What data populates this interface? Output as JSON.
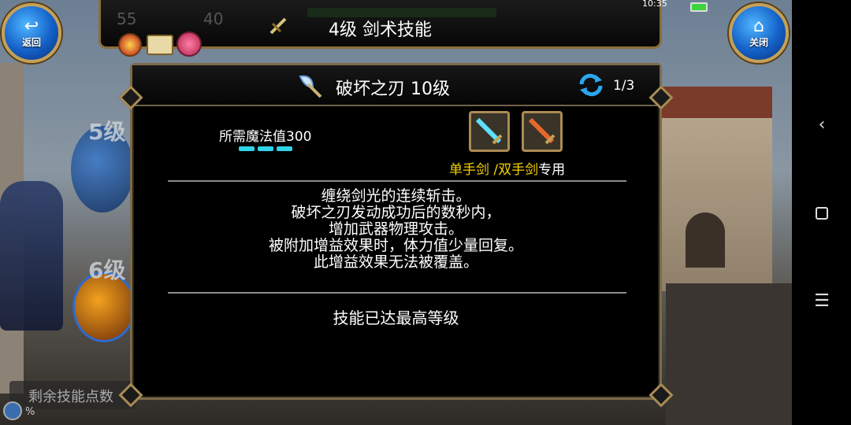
{
  "top_bar": {
    "title": "4级 剑术技能",
    "back_label": "返回",
    "close_label": "关闭",
    "faded_num_a": "55",
    "faded_num_b": "40"
  },
  "system": {
    "time": "10:35"
  },
  "background": {
    "level_5": "5级",
    "level_6": "6级",
    "remaining_points_label": "剩余技能点数",
    "percent": "%"
  },
  "skill": {
    "name": "破坏之刃 10级",
    "page": "1/3",
    "mp_label": "所需魔法值300",
    "weapon_note": "单手剑 /双手剑",
    "weapon_suffix": "专用",
    "description": [
      "缠绕剑光的连续斩击。",
      "破坏之刃发动成功后的数秒内，",
      "增加武器物理攻击。",
      "被附加增益效果时，体力值少量回复。",
      "此增益效果无法被覆盖。"
    ],
    "status": "技能已达最高等级"
  },
  "colors": {
    "accent_gold": "#f5d000",
    "mp_bar": "#2fd4e8",
    "frame": "#8c6e3a"
  }
}
